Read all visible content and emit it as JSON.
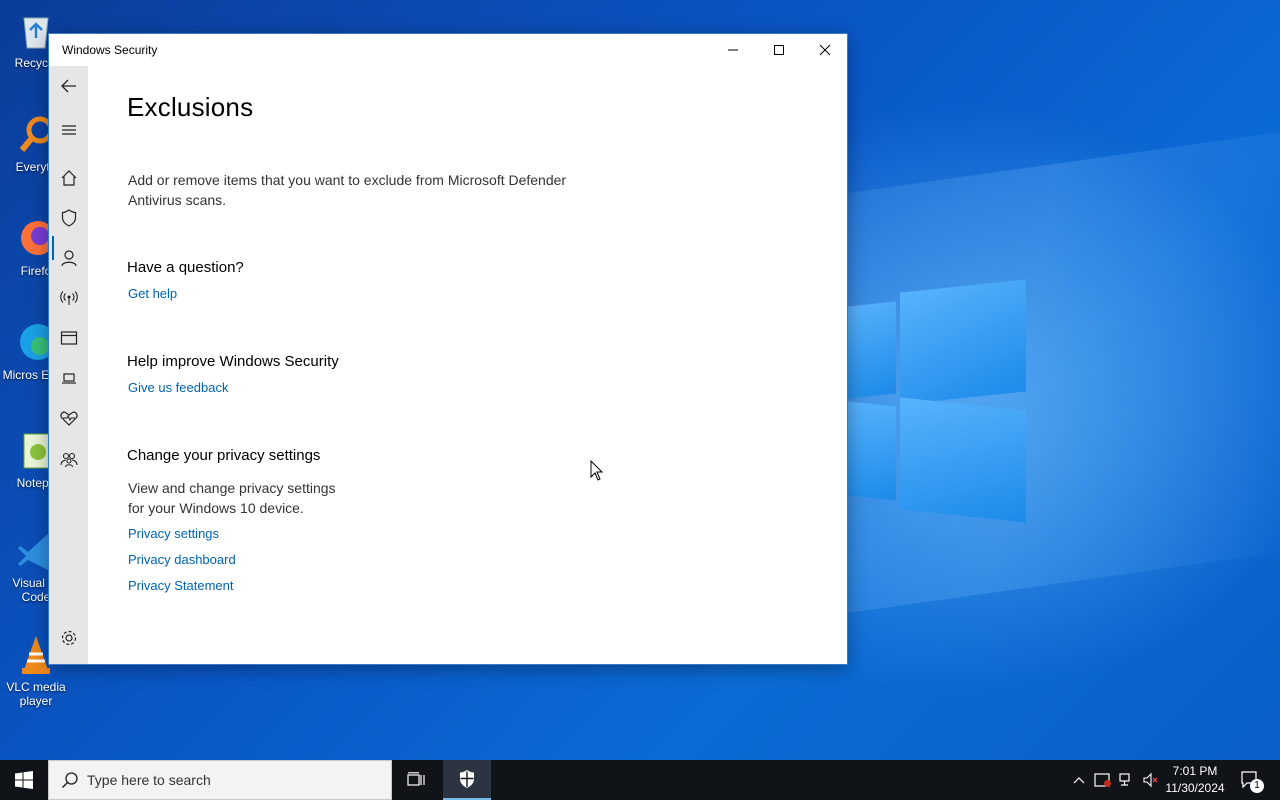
{
  "desktop": {
    "icons": [
      {
        "label": "Recycle",
        "icon": "recycle-bin-icon"
      },
      {
        "label": "Everyth",
        "icon": "everything-search-icon"
      },
      {
        "label": "Firefo",
        "icon": "firefox-icon"
      },
      {
        "label": "Micros Edge",
        "icon": "edge-icon"
      },
      {
        "label": "Notepa",
        "icon": "notepad-plus-plus-icon"
      },
      {
        "label": "Visual St Code",
        "icon": "vscode-icon"
      },
      {
        "label": "VLC media player",
        "icon": "vlc-icon"
      }
    ]
  },
  "window": {
    "title": "Windows Security",
    "controls": {
      "minimize": "minimize-icon",
      "maximize": "maximize-icon",
      "close": "close-icon"
    }
  },
  "nav": {
    "items": [
      "back-arrow-icon",
      "hamburger-menu-icon",
      "home-icon",
      "shield-icon",
      "person-icon",
      "wireless-icon",
      "app-browser-icon",
      "laptop-icon",
      "heart-pulse-icon",
      "family-icon",
      "gear-icon"
    ],
    "selected": "shield-icon"
  },
  "page": {
    "title": "Exclusions",
    "description_line1": "Add or remove items that you want to exclude from Microsoft Defender",
    "description_line2": "Antivirus scans.",
    "question": {
      "heading": "Have a question?",
      "link": "Get help"
    },
    "improve": {
      "heading": "Help improve Windows Security",
      "link": "Give us feedback"
    },
    "privacy": {
      "heading": "Change your privacy settings",
      "text_line1": "View and change privacy settings",
      "text_line2": "for your Windows 10 device.",
      "links": [
        "Privacy settings",
        "Privacy dashboard",
        "Privacy Statement"
      ]
    }
  },
  "taskbar": {
    "search_placeholder": "Type here to search",
    "time": "7:01 PM",
    "date": "11/30/2024",
    "notification_count": "1"
  },
  "colors": {
    "link": "#0063b1",
    "taskbar": "#101418",
    "nav_bg": "#e6e6e6"
  }
}
